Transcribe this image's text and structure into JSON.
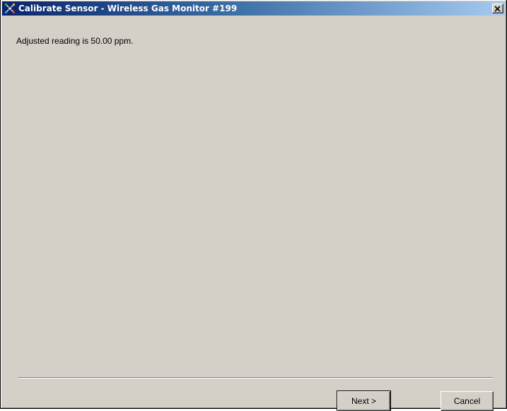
{
  "window": {
    "title": "Calibrate Sensor - Wireless Gas Monitor #199",
    "icon": "calibrate-sensor-icon"
  },
  "titlebar": {
    "close_icon": "close-icon"
  },
  "main": {
    "message": "Adjusted reading is 50.00 ppm."
  },
  "buttons": {
    "next_label": "Next >",
    "cancel_label": "Cancel"
  },
  "colors": {
    "titlebar_start": "#0a246a",
    "titlebar_end": "#a6caf0",
    "dialog_background": "#d4d0c8"
  }
}
